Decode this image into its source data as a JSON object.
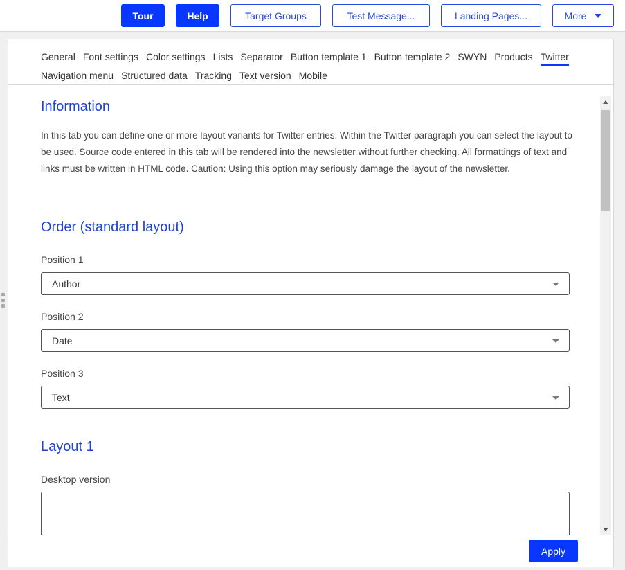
{
  "toolbar": {
    "tour": "Tour",
    "help": "Help",
    "target_groups": "Target Groups",
    "test_message": "Test Message...",
    "landing_pages": "Landing Pages...",
    "more": "More"
  },
  "tabs": {
    "row1": [
      "General",
      "Font settings",
      "Color settings",
      "Lists",
      "Separator",
      "Button template 1",
      "Button template 2",
      "SWYN",
      "Products",
      "Twitter"
    ],
    "row2": [
      "Navigation menu",
      "Structured data",
      "Tracking",
      "Text version",
      "Mobile"
    ],
    "active": "Twitter"
  },
  "info": {
    "title": "Information",
    "text": "In this tab you can define one or more layout variants for Twitter entries. Within the Twitter paragraph you can select the layout to be used. Source code entered in this tab will be rendered into the newsletter without further checking. All formattings of text and links must be written in HTML code. Caution: Using this option may seriously damage the layout of the newsletter."
  },
  "order": {
    "title": "Order (standard layout)",
    "position1_label": "Position 1",
    "position1_value": "Author",
    "position2_label": "Position 2",
    "position2_value": "Date",
    "position3_label": "Position 3",
    "position3_value": "Text"
  },
  "layout1": {
    "title": "Layout 1",
    "desktop_label": "Desktop version",
    "desktop_value": ""
  },
  "footer": {
    "apply": "Apply"
  },
  "colors": {
    "primary": "#0a37ff",
    "heading": "#1f45d0"
  }
}
